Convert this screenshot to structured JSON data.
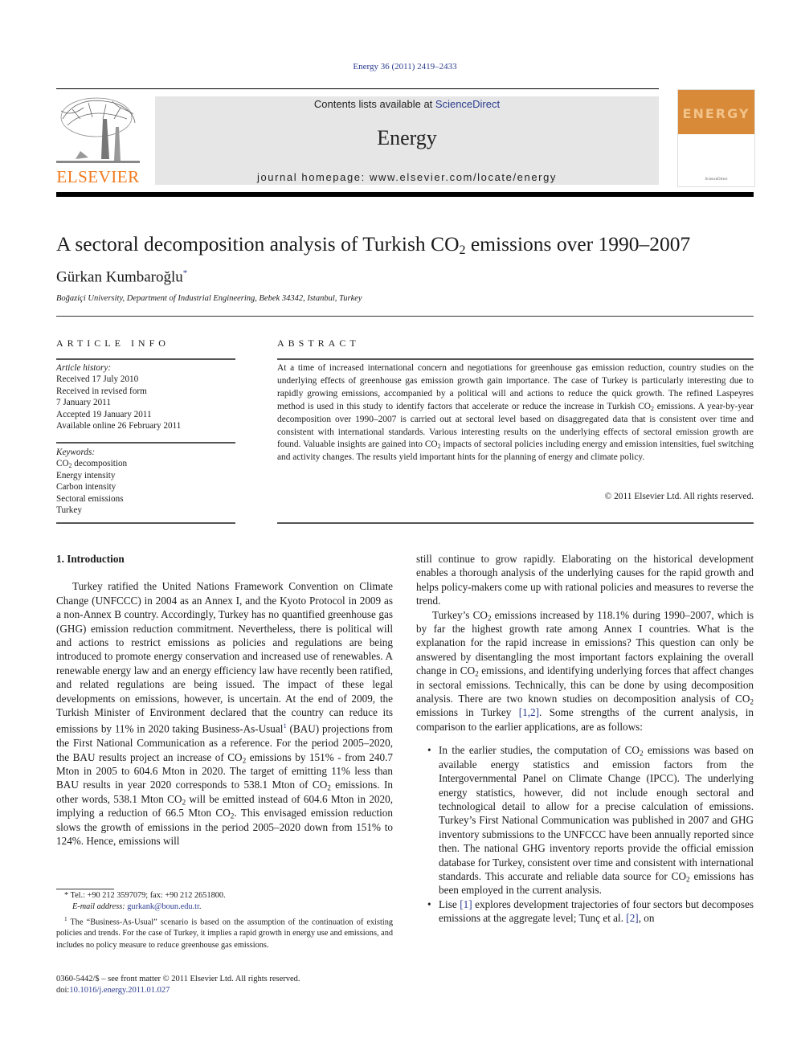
{
  "header": {
    "citation": "Energy 36 (2011) 2419–2433",
    "contents_prefix": "Contents lists available at ",
    "contents_link": "ScienceDirect",
    "journal_name": "Energy",
    "homepage": "journal homepage: www.elsevier.com/locate/energy",
    "publisher_logo_text": "ELSEVIER",
    "cover_title": "ENERGY",
    "cover_subtitle": "ScienceDirect",
    "colors": {
      "elsevier_orange": "#f07a1e",
      "link_blue": "#2a3b8f",
      "cover_orange": "#d88a38",
      "journal_box_gray": "#e6e6e6"
    }
  },
  "article": {
    "title_pre": "A sectoral decomposition analysis of Turkish CO",
    "title_sub": "2",
    "title_post": " emissions over 1990‒2007",
    "author": "Gürkan Kumbaroğlu",
    "author_mark": "*",
    "affiliation": "Boğaziçi University, Department of Industrial Engineering, Bebek 34342, Istanbul, Turkey"
  },
  "article_info": {
    "heading": "ARTICLE INFO",
    "history_label": "Article history:",
    "history": [
      "Received 17 July 2010",
      "Received in revised form",
      "7 January 2011",
      "Accepted 19 January 2011",
      "Available online 26 February 2011"
    ],
    "keywords_label": "Keywords:",
    "keyword_co2_pre": "CO",
    "keyword_co2_sub": "2",
    "keyword_co2_post": " decomposition",
    "keywords": [
      "Energy intensity",
      "Carbon intensity",
      "Sectoral emissions",
      "Turkey"
    ]
  },
  "abstract": {
    "heading": "ABSTRACT",
    "p1": "At a time of increased international concern and negotiations for greenhouse gas emission reduction, country studies on the underlying effects of greenhouse gas emission growth gain importance. The case of Turkey is particularly interesting due to rapidly growing emissions, accompanied by a political will and actions to reduce the quick growth. The refined Laspeyres method is used in this study to identify factors that accelerate or reduce the increase in Turkish CO",
    "p2": " emissions. A year-by-year decomposition over 1990‒2007 is carried out at sectoral level based on disaggregated data that is consistent over time and consistent with international standards. Various interesting results on the underlying effects of sectoral emission growth are found. Valuable insights are gained into CO",
    "p3": " impacts of sectoral policies including energy and emission intensities, fuel switching and activity changes. The results yield important hints for the planning of energy and climate policy.",
    "sub": "2",
    "copyright": "© 2011 Elsevier Ltd. All rights reserved."
  },
  "intro": {
    "heading": "1.  Introduction",
    "left_a": "Turkey ratified the United Nations Framework Convention on Climate Change (UNFCCC) in 2004 as an Annex I, and the Kyoto Protocol in 2009 as a non-Annex B country. Accordingly, Turkey has no quantified greenhouse gas (GHG) emission reduction commitment. Nevertheless, there is political will and actions to restrict emissions as policies and regulations are being introduced to promote energy conservation and increased use of renewables. A renewable energy law and an energy efficiency law have recently been ratified, and related regulations are being issued. The impact of these legal developments on emissions, however, is uncertain. At the end of 2009, the Turkish Minister of Environment declared that the country can reduce its emissions by 11% in 2020 taking Business-As-Usual",
    "left_fn": "1",
    "left_b": " (BAU) projections from the First National Communication as a reference. For the period 2005‒2020, the BAU results project an increase of CO",
    "left_c": " emissions by 151% - from 240.7 Mton in 2005 to 604.6 Mton in 2020. The target of emitting 11% less than BAU results in year 2020 corresponds to 538.1 Mton of CO",
    "left_d": " emissions. In other words, 538.1 Mton CO",
    "left_e": " will be emitted instead of 604.6 Mton in 2020, implying a reduction of 66.5 Mton CO",
    "left_f": ". This envisaged emission reduction slows the growth of emissions in the period 2005‒2020 down from 151% to 124%. Hence, emissions will",
    "sub": "2",
    "right_p1": "still continue to grow rapidly. Elaborating on the historical development enables a thorough analysis of the underlying causes for the rapid growth and helps policy-makers come up with rational policies and measures to reverse the trend.",
    "right_p2_a": "Turkey’s CO",
    "right_p2_b": " emissions increased by 118.1% during 1990‒2007, which is by far the highest growth rate among Annex I countries. What is the explanation for the rapid increase in emissions? This question can only be answered by disentangling the most important factors explaining the overall change in CO",
    "right_p2_c": " emissions, and identifying underlying forces that affect changes in sectoral emissions. Technically, this can be done by using decomposition analysis. There are two known studies on decomposition analysis of CO",
    "right_p2_d": " emissions in Turkey ",
    "right_p2_ref": "[1,2]",
    "right_p2_e": ". Some strengths of the current analysis, in comparison to the earlier applications, are as follows:",
    "bullet_glyph": "•",
    "bullet1_a": "In the earlier studies, the computation of CO",
    "bullet1_b": " emissions was based on available energy statistics and emission factors from the Intergovernmental Panel on Climate Change (IPCC). The underlying energy statistics, however, did not include enough sectoral and technological detail to allow for a precise calculation of emissions. Turkey’s First National Communication was published in 2007 and GHG inventory submissions to the UNFCCC have been annually reported since then. The national GHG inventory reports provide the official emission database for Turkey, consistent over time and consistent with international standards. This accurate and reliable data source for CO",
    "bullet1_c": " emissions has been employed in the current analysis.",
    "bullet2_a": "Lise ",
    "bullet2_ref1": "[1]",
    "bullet2_b": " explores development trajectories of four sectors but decomposes emissions at the aggregate level; Tunç et al. ",
    "bullet2_ref2": "[2]",
    "bullet2_c": ", on"
  },
  "footnotes": {
    "star_mark": "*",
    "contact": " Tel.: +90 212 3597079; fax: +90 212 2651800.",
    "email_label": "E-mail address: ",
    "email": "gurkank@boun.edu.tr",
    "email_end": ".",
    "fn1_mark": "1",
    "fn1": " The “Business-As-Usual” scenario is based on the assumption of the continuation of existing policies and trends. For the case of Turkey, it implies a rapid growth in energy use and emissions, and includes no policy measure to reduce greenhouse gas emissions.",
    "front_matter": "0360-5442/$ ‒ see front matter © 2011 Elsevier Ltd. All rights reserved.",
    "doi_label": "doi:",
    "doi": "10.1016/j.energy.2011.01.027"
  }
}
